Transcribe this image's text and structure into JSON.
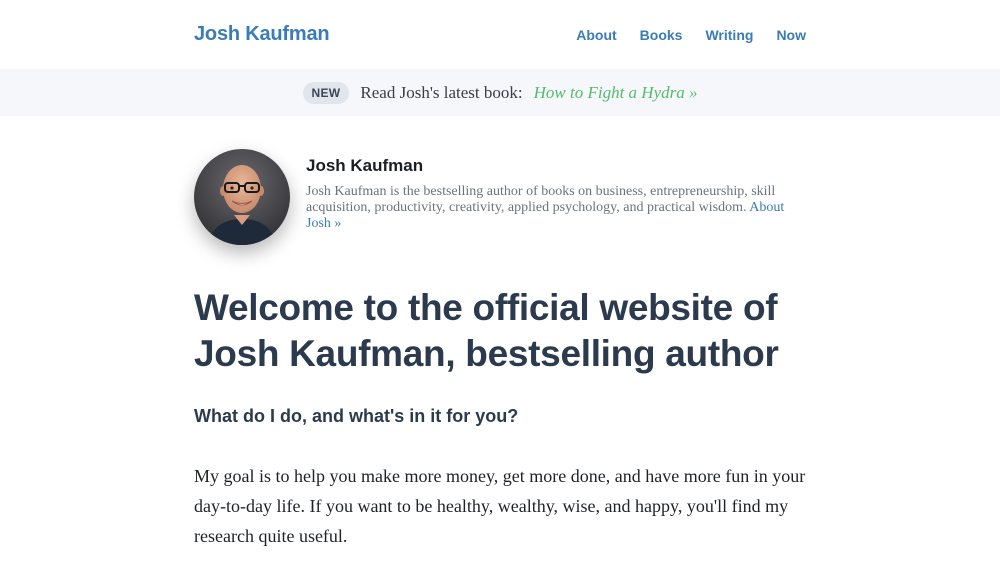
{
  "header": {
    "site_title": "Josh Kaufman",
    "nav": [
      {
        "label": "About"
      },
      {
        "label": "Books"
      },
      {
        "label": "Writing"
      },
      {
        "label": "Now"
      }
    ]
  },
  "banner": {
    "badge": "NEW",
    "text": "Read Josh's latest book:",
    "link": "How to Fight a Hydra »"
  },
  "author": {
    "name": "Josh Kaufman",
    "bio": "Josh Kaufman is the bestselling author of books on business, entrepreneurship, skill acquisition, productivity, creativity, applied psychology, and practical wisdom.",
    "bio_link": "About Josh »"
  },
  "main": {
    "title": "Welcome to the official website of Josh Kaufman, bestselling author",
    "subtitle": "What do I do, and what's in it for you?",
    "paragraph": "My goal is to help you make more money, get more done, and have more fun in your day-to-day life. If you want to be healthy, wealthy, wise, and happy, you'll find my research quite useful."
  },
  "colors": {
    "accent_link": "#3a7cb8",
    "accent_green": "#56b96c",
    "heading": "#2c3a4e",
    "banner_bg": "#f5f7fa"
  }
}
